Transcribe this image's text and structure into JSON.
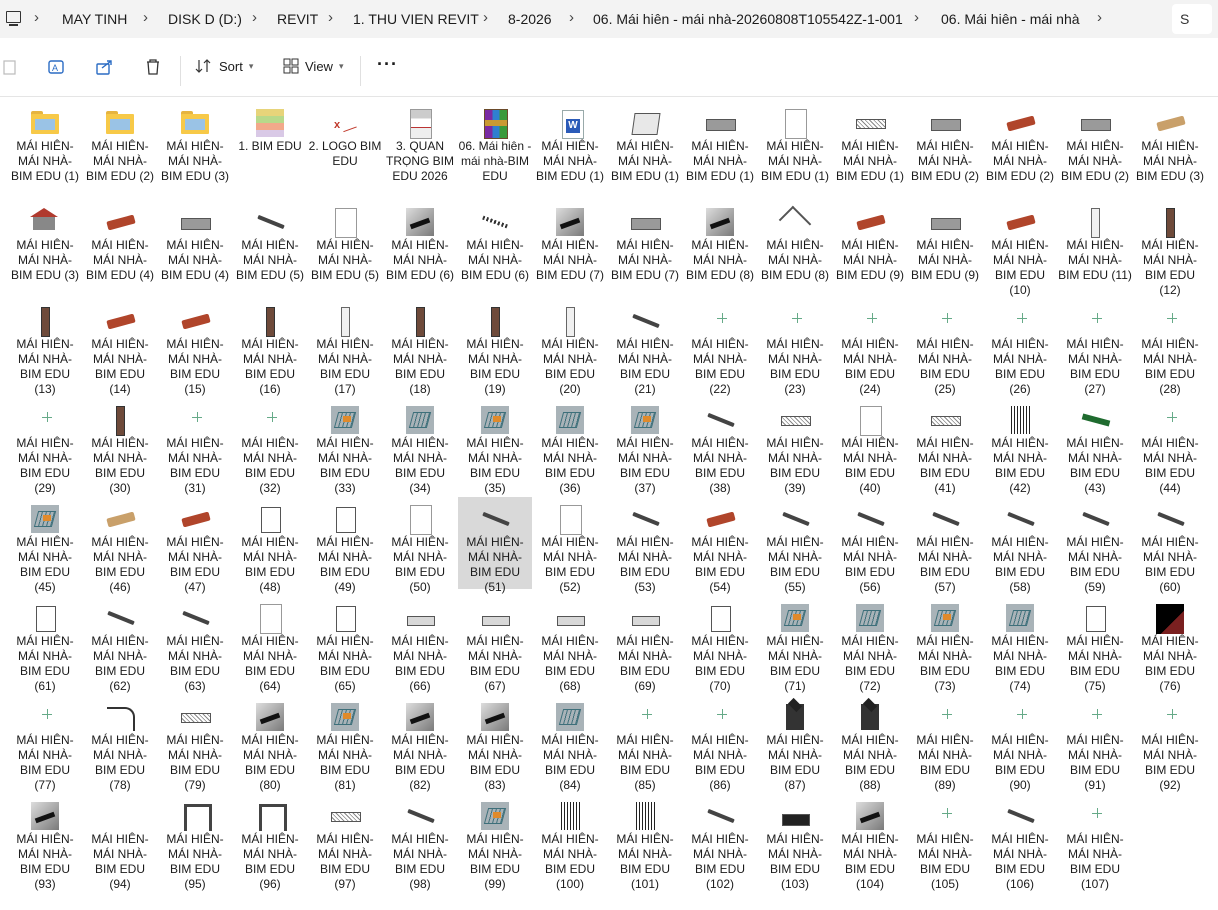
{
  "breadcrumbs": [
    "MAY TINH",
    "DISK D (D:)",
    "REVIT",
    "1. THU VIEN REVIT",
    "8-2026",
    "06. Mái hiên - mái nhà-20260808T105542Z-1-001",
    "06. Mái hiên - mái nhà"
  ],
  "search_initial": "S",
  "toolbar": {
    "sort_label": "Sort",
    "view_label": "View",
    "more_label": "···"
  },
  "items": [
    {
      "label": "MÁI HIÊN-MÁI NHÀ-BIM EDU (1)",
      "icon": "folder-icon"
    },
    {
      "label": "MÁI HIÊN-MÁI NHÀ-BIM EDU (2)",
      "icon": "folder-icon"
    },
    {
      "label": "MÁI HIÊN-MÁI NHÀ-BIM EDU (3)",
      "icon": "folder-icon"
    },
    {
      "label": "1. BIM EDU",
      "icon": "image-icon"
    },
    {
      "label": "2. LOGO BIM EDU",
      "icon": "logo-image-icon"
    },
    {
      "label": "3. QUAN TRỌNG BIM EDU 2026",
      "icon": "document-image-icon"
    },
    {
      "label": "06. Mái hiên - mái nhà-BIM EDU",
      "icon": "rar-archive-icon"
    },
    {
      "label": "MÁI HIÊN-MÁI NHÀ-BIM EDU (1)",
      "icon": "word-document-icon"
    },
    {
      "label": "MÁI HIÊN-MÁI NHÀ-BIM EDU (1)",
      "icon": "window-model-icon"
    },
    {
      "label": "MÁI HIÊN-MÁI NHÀ-BIM EDU (1)",
      "icon": "model-icon"
    },
    {
      "label": "MÁI HIÊN-MÁI NHÀ-BIM EDU (1)",
      "icon": "blank-file-icon"
    },
    {
      "label": "MÁI HIÊN-MÁI NHÀ-BIM EDU (1)",
      "icon": "truss-model-icon"
    },
    {
      "label": "MÁI HIÊN-MÁI NHÀ-BIM EDU (2)",
      "icon": "model-icon"
    },
    {
      "label": "MÁI HIÊN-MÁI NHÀ-BIM EDU (2)",
      "icon": "tile-model-icon"
    },
    {
      "label": "MÁI HIÊN-MÁI NHÀ-BIM EDU (2)",
      "icon": "model-icon"
    },
    {
      "label": "MÁI HIÊN-MÁI NHÀ-BIM EDU (3)",
      "icon": "tile-model-icon"
    },
    {
      "label": "MÁI HIÊN-MÁI NHÀ-BIM EDU (3)",
      "icon": "house-model-icon"
    },
    {
      "label": "MÁI HIÊN-MÁI NHÀ-BIM EDU (4)",
      "icon": "tile-model-icon"
    },
    {
      "label": "MÁI HIÊN-MÁI NHÀ-BIM EDU (4)",
      "icon": "model-icon"
    },
    {
      "label": "MÁI HIÊN-MÁI NHÀ-BIM EDU (5)",
      "icon": "beam-model-icon"
    },
    {
      "label": "MÁI HIÊN-MÁI NHÀ-BIM EDU (5)",
      "icon": "blank-file-icon"
    },
    {
      "label": "MÁI HIÊN-MÁI NHÀ-BIM EDU (6)",
      "icon": "gray-model-icon"
    },
    {
      "label": "MÁI HIÊN-MÁI NHÀ-BIM EDU (6)",
      "icon": "dots-model-icon"
    },
    {
      "label": "MÁI HIÊN-MÁI NHÀ-BIM EDU (7)",
      "icon": "gray-model-icon"
    },
    {
      "label": "MÁI HIÊN-MÁI NHÀ-BIM EDU (7)",
      "icon": "model-icon"
    },
    {
      "label": "MÁI HIÊN-MÁI NHÀ-BIM EDU (8)",
      "icon": "gray-model-icon"
    },
    {
      "label": "MÁI HIÊN-MÁI NHÀ-BIM EDU (8)",
      "icon": "roof-model-icon"
    },
    {
      "label": "MÁI HIÊN-MÁI NHÀ-BIM EDU (9)",
      "icon": "tile-model-icon"
    },
    {
      "label": "MÁI HIÊN-MÁI NHÀ-BIM EDU (9)",
      "icon": "model-icon"
    },
    {
      "label": "MÁI HIÊN-MÁI NHÀ-BIM EDU (10)",
      "icon": "tile-model-icon"
    },
    {
      "label": "MÁI HIÊN-MÁI NHÀ-BIM EDU (11)",
      "icon": "column-model-icon"
    },
    {
      "label": "MÁI HIÊN-MÁI NHÀ-BIM EDU (12)",
      "icon": "column-model-icon"
    },
    {
      "label": "MÁI HIÊN-MÁI NHÀ-BIM EDU (13)",
      "icon": "column-model-icon"
    },
    {
      "label": "MÁI HIÊN-MÁI NHÀ-BIM EDU (14)",
      "icon": "tile-model-icon"
    },
    {
      "label": "MÁI HIÊN-MÁI NHÀ-BIM EDU (15)",
      "icon": "tile-model-icon"
    },
    {
      "label": "MÁI HIÊN-MÁI NHÀ-BIM EDU (16)",
      "icon": "column-model-icon"
    },
    {
      "label": "MÁI HIÊN-MÁI NHÀ-BIM EDU (17)",
      "icon": "column-model-icon"
    },
    {
      "label": "MÁI HIÊN-MÁI NHÀ-BIM EDU (18)",
      "icon": "column-model-icon"
    },
    {
      "label": "MÁI HIÊN-MÁI NHÀ-BIM EDU (19)",
      "icon": "column-model-icon"
    },
    {
      "label": "MÁI HIÊN-MÁI NHÀ-BIM EDU (20)",
      "icon": "column-model-icon"
    },
    {
      "label": "MÁI HIÊN-MÁI NHÀ-BIM EDU (21)",
      "icon": "beam-model-icon"
    },
    {
      "label": "MÁI HIÊN-MÁI NHÀ-BIM EDU (22)",
      "icon": "crosshair-model-icon"
    },
    {
      "label": "MÁI HIÊN-MÁI NHÀ-BIM EDU (23)",
      "icon": "crosshair-model-icon"
    },
    {
      "label": "MÁI HIÊN-MÁI NHÀ-BIM EDU (24)",
      "icon": "crosshair-model-icon"
    },
    {
      "label": "MÁI HIÊN-MÁI NHÀ-BIM EDU (25)",
      "icon": "crosshair-model-icon"
    },
    {
      "label": "MÁI HIÊN-MÁI NHÀ-BIM EDU (26)",
      "icon": "crosshair-model-icon"
    },
    {
      "label": "MÁI HIÊN-MÁI NHÀ-BIM EDU (27)",
      "icon": "crosshair-model-icon"
    },
    {
      "label": "MÁI HIÊN-MÁI NHÀ-BIM EDU (28)",
      "icon": "crosshair-model-icon"
    },
    {
      "label": "MÁI HIÊN-MÁI NHÀ-BIM EDU (29)",
      "icon": "crosshair-model-icon"
    },
    {
      "label": "MÁI HIÊN-MÁI NHÀ-BIM EDU (30)",
      "icon": "column-model-icon"
    },
    {
      "label": "MÁI HIÊN-MÁI NHÀ-BIM EDU (31)",
      "icon": "crosshair-model-icon"
    },
    {
      "label": "MÁI HIÊN-MÁI NHÀ-BIM EDU (32)",
      "icon": "crosshair-model-icon"
    },
    {
      "label": "MÁI HIÊN-MÁI NHÀ-BIM EDU (33)",
      "icon": "plan-model-icon"
    },
    {
      "label": "MÁI HIÊN-MÁI NHÀ-BIM EDU (34)",
      "icon": "plan-model-icon"
    },
    {
      "label": "MÁI HIÊN-MÁI NHÀ-BIM EDU (35)",
      "icon": "plan-model-icon"
    },
    {
      "label": "MÁI HIÊN-MÁI NHÀ-BIM EDU (36)",
      "icon": "plan-model-icon"
    },
    {
      "label": "MÁI HIÊN-MÁI NHÀ-BIM EDU (37)",
      "icon": "plan-model-icon"
    },
    {
      "label": "MÁI HIÊN-MÁI NHÀ-BIM EDU (38)",
      "icon": "beam-model-icon"
    },
    {
      "label": "MÁI HIÊN-MÁI NHÀ-BIM EDU (39)",
      "icon": "truss-model-icon"
    },
    {
      "label": "MÁI HIÊN-MÁI NHÀ-BIM EDU (40)",
      "icon": "blank-file-icon"
    },
    {
      "label": "MÁI HIÊN-MÁI NHÀ-BIM EDU (41)",
      "icon": "truss-model-icon"
    },
    {
      "label": "MÁI HIÊN-MÁI NHÀ-BIM EDU (42)",
      "icon": "bars-model-icon"
    },
    {
      "label": "MÁI HIÊN-MÁI NHÀ-BIM EDU (43)",
      "icon": "green-model-icon"
    },
    {
      "label": "MÁI HIÊN-MÁI NHÀ-BIM EDU (44)",
      "icon": "crosshair-model-icon"
    },
    {
      "label": "MÁI HIÊN-MÁI NHÀ-BIM EDU (45)",
      "icon": "plan-model-icon"
    },
    {
      "label": "MÁI HIÊN-MÁI NHÀ-BIM EDU (46)",
      "icon": "tile-model-icon"
    },
    {
      "label": "MÁI HIÊN-MÁI NHÀ-BIM EDU (47)",
      "icon": "tile-model-icon"
    },
    {
      "label": "MÁI HIÊN-MÁI NHÀ-BIM EDU (48)",
      "icon": "box-model-icon"
    },
    {
      "label": "MÁI HIÊN-MÁI NHÀ-BIM EDU (49)",
      "icon": "box-model-icon"
    },
    {
      "label": "MÁI HIÊN-MÁI NHÀ-BIM EDU (50)",
      "icon": "blank-file-icon"
    },
    {
      "label": "MÁI HIÊN-MÁI NHÀ-BIM EDU (51)",
      "icon": "beam-model-icon",
      "selected": true
    },
    {
      "label": "MÁI HIÊN-MÁI NHÀ-BIM EDU (52)",
      "icon": "blank-file-icon"
    },
    {
      "label": "MÁI HIÊN-MÁI NHÀ-BIM EDU (53)",
      "icon": "beam-model-icon"
    },
    {
      "label": "MÁI HIÊN-MÁI NHÀ-BIM EDU (54)",
      "icon": "tile-model-icon"
    },
    {
      "label": "MÁI HIÊN-MÁI NHÀ-BIM EDU (55)",
      "icon": "beam-model-icon"
    },
    {
      "label": "MÁI HIÊN-MÁI NHÀ-BIM EDU (56)",
      "icon": "beam-model-icon"
    },
    {
      "label": "MÁI HIÊN-MÁI NHÀ-BIM EDU (57)",
      "icon": "beam-model-icon"
    },
    {
      "label": "MÁI HIÊN-MÁI NHÀ-BIM EDU (58)",
      "icon": "beam-model-icon"
    },
    {
      "label": "MÁI HIÊN-MÁI NHÀ-BIM EDU (59)",
      "icon": "beam-model-icon"
    },
    {
      "label": "MÁI HIÊN-MÁI NHÀ-BIM EDU (60)",
      "icon": "beam-model-icon"
    },
    {
      "label": "MÁI HIÊN-MÁI NHÀ-BIM EDU (61)",
      "icon": "box-model-icon"
    },
    {
      "label": "MÁI HIÊN-MÁI NHÀ-BIM EDU (62)",
      "icon": "beam-model-icon"
    },
    {
      "label": "MÁI HIÊN-MÁI NHÀ-BIM EDU (63)",
      "icon": "beam-model-icon"
    },
    {
      "label": "MÁI HIÊN-MÁI NHÀ-BIM EDU (64)",
      "icon": "blank-file-icon"
    },
    {
      "label": "MÁI HIÊN-MÁI NHÀ-BIM EDU (65)",
      "icon": "box-model-icon"
    },
    {
      "label": "MÁI HIÊN-MÁI NHÀ-BIM EDU (66)",
      "icon": "slab-model-icon"
    },
    {
      "label": "MÁI HIÊN-MÁI NHÀ-BIM EDU (67)",
      "icon": "slab-model-icon"
    },
    {
      "label": "MÁI HIÊN-MÁI NHÀ-BIM EDU (68)",
      "icon": "slab-model-icon"
    },
    {
      "label": "MÁI HIÊN-MÁI NHÀ-BIM EDU (69)",
      "icon": "slab-model-icon"
    },
    {
      "label": "MÁI HIÊN-MÁI NHÀ-BIM EDU (70)",
      "icon": "box-model-icon"
    },
    {
      "label": "MÁI HIÊN-MÁI NHÀ-BIM EDU (71)",
      "icon": "plan-model-icon"
    },
    {
      "label": "MÁI HIÊN-MÁI NHÀ-BIM EDU (72)",
      "icon": "plan-model-icon"
    },
    {
      "label": "MÁI HIÊN-MÁI NHÀ-BIM EDU (73)",
      "icon": "plan-model-icon"
    },
    {
      "label": "MÁI HIÊN-MÁI NHÀ-BIM EDU (74)",
      "icon": "plan-model-icon"
    },
    {
      "label": "MÁI HIÊN-MÁI NHÀ-BIM EDU (75)",
      "icon": "box-model-icon"
    },
    {
      "label": "MÁI HIÊN-MÁI NHÀ-BIM EDU (76)",
      "icon": "black-model-icon"
    },
    {
      "label": "MÁI HIÊN-MÁI NHÀ-BIM EDU (77)",
      "icon": "crosshair-model-icon"
    },
    {
      "label": "MÁI HIÊN-MÁI NHÀ-BIM EDU (78)",
      "icon": "curve-model-icon"
    },
    {
      "label": "MÁI HIÊN-MÁI NHÀ-BIM EDU (79)",
      "icon": "truss-model-icon"
    },
    {
      "label": "MÁI HIÊN-MÁI NHÀ-BIM EDU (80)",
      "icon": "gray-model-icon"
    },
    {
      "label": "MÁI HIÊN-MÁI NHÀ-BIM EDU (81)",
      "icon": "plan-model-icon"
    },
    {
      "label": "MÁI HIÊN-MÁI NHÀ-BIM EDU (82)",
      "icon": "gray-model-icon"
    },
    {
      "label": "MÁI HIÊN-MÁI NHÀ-BIM EDU (83)",
      "icon": "gray-model-icon"
    },
    {
      "label": "MÁI HIÊN-MÁI NHÀ-BIM EDU (84)",
      "icon": "plan-model-icon"
    },
    {
      "label": "MÁI HIÊN-MÁI NHÀ-BIM EDU (85)",
      "icon": "crosshair-model-icon"
    },
    {
      "label": "MÁI HIÊN-MÁI NHÀ-BIM EDU (86)",
      "icon": "crosshair-model-icon"
    },
    {
      "label": "MÁI HIÊN-MÁI NHÀ-BIM EDU (87)",
      "icon": "lantern-model-icon"
    },
    {
      "label": "MÁI HIÊN-MÁI NHÀ-BIM EDU (88)",
      "icon": "lantern-model-icon"
    },
    {
      "label": "MÁI HIÊN-MÁI NHÀ-BIM EDU (89)",
      "icon": "crosshair-model-icon"
    },
    {
      "label": "MÁI HIÊN-MÁI NHÀ-BIM EDU (90)",
      "icon": "crosshair-model-icon"
    },
    {
      "label": "MÁI HIÊN-MÁI NHÀ-BIM EDU (91)",
      "icon": "crosshair-model-icon"
    },
    {
      "label": "MÁI HIÊN-MÁI NHÀ-BIM EDU (92)",
      "icon": "crosshair-model-icon"
    },
    {
      "label": "MÁI HIÊN-MÁI NHÀ-BIM EDU (93)",
      "icon": "gray-model-icon"
    },
    {
      "label": "MÁI HIÊN-MÁI NHÀ-BIM EDU (94)",
      "icon": "blank-model-icon"
    },
    {
      "label": "MÁI HIÊN-MÁI NHÀ-BIM EDU (95)",
      "icon": "frame-model-icon"
    },
    {
      "label": "MÁI HIÊN-MÁI NHÀ-BIM EDU (96)",
      "icon": "frame-model-icon"
    },
    {
      "label": "MÁI HIÊN-MÁI NHÀ-BIM EDU (97)",
      "icon": "truss-model-icon"
    },
    {
      "label": "MÁI HIÊN-MÁI NHÀ-BIM EDU (98)",
      "icon": "beam-model-icon"
    },
    {
      "label": "MÁI HIÊN-MÁI NHÀ-BIM EDU (99)",
      "icon": "plan-model-icon"
    },
    {
      "label": "MÁI HIÊN-MÁI NHÀ-BIM EDU (100)",
      "icon": "bars-model-icon"
    },
    {
      "label": "MÁI HIÊN-MÁI NHÀ-BIM EDU (101)",
      "icon": "bars-model-icon"
    },
    {
      "label": "MÁI HIÊN-MÁI NHÀ-BIM EDU (102)",
      "icon": "beam-model-icon"
    },
    {
      "label": "MÁI HIÊN-MÁI NHÀ-BIM EDU (103)",
      "icon": "dark-slab-model-icon"
    },
    {
      "label": "MÁI HIÊN-MÁI NHÀ-BIM EDU (104)",
      "icon": "gray-model-icon"
    },
    {
      "label": "MÁI HIÊN-MÁI NHÀ-BIM EDU (105)",
      "icon": "crosshair-model-icon"
    },
    {
      "label": "MÁI HIÊN-MÁI NHÀ-BIM EDU (106)",
      "icon": "beam-model-icon"
    },
    {
      "label": "MÁI HIÊN-MÁI NHÀ-BIM EDU (107)",
      "icon": "crosshair-model-icon"
    }
  ]
}
